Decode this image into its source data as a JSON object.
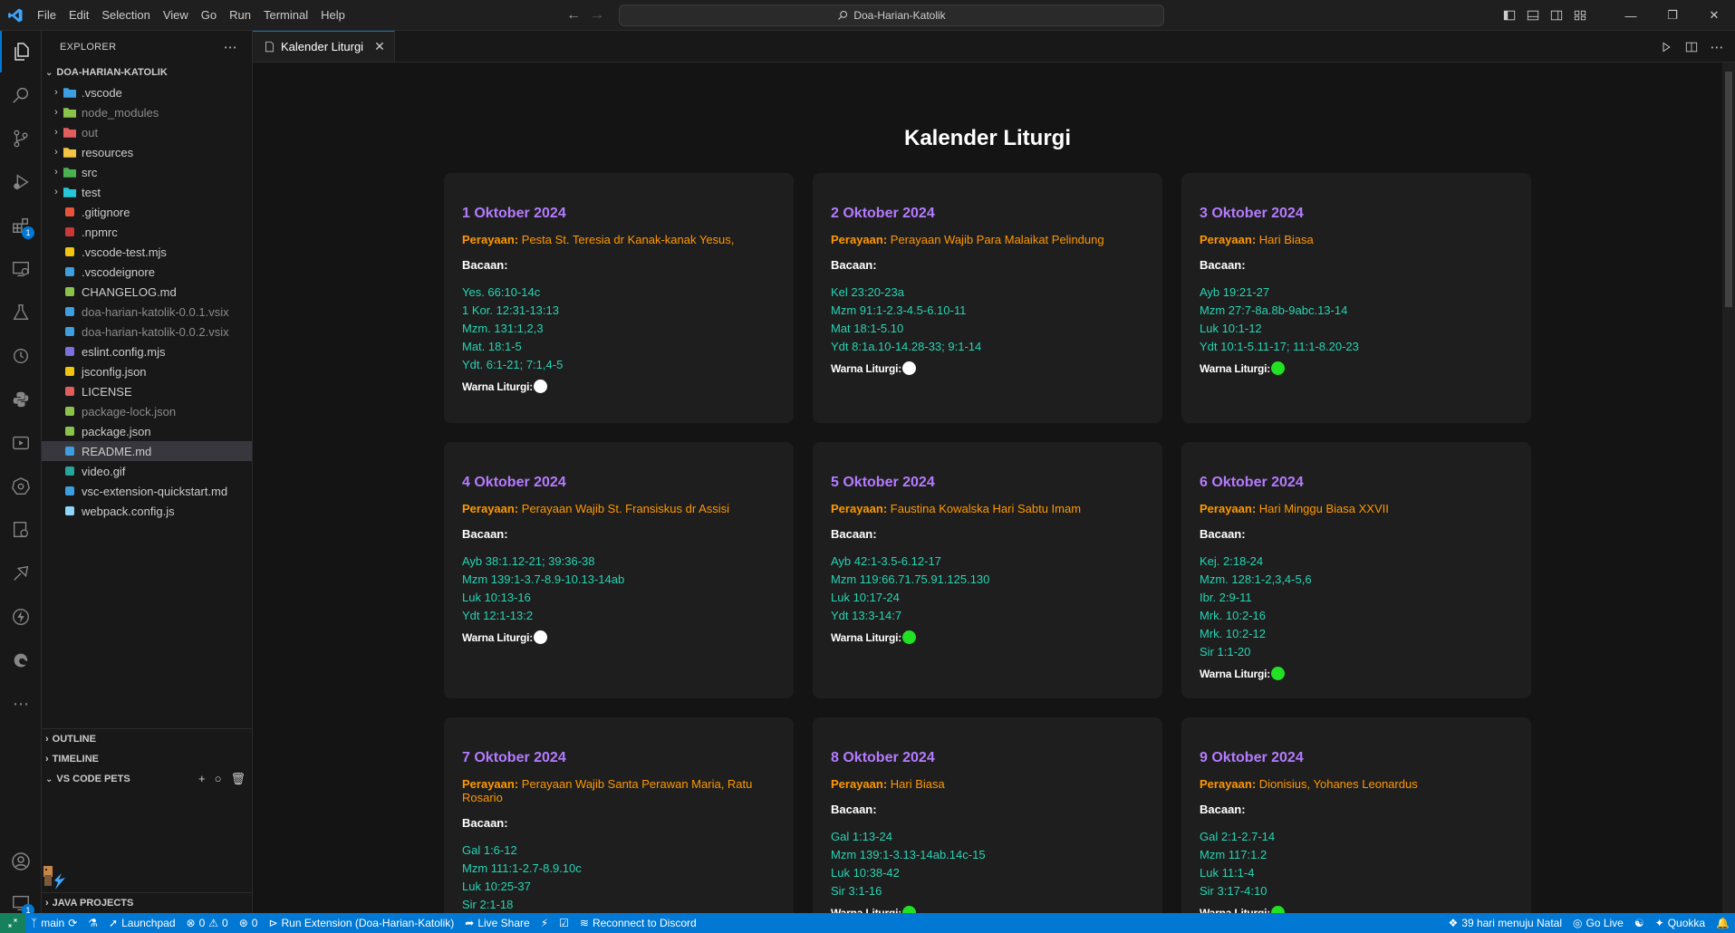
{
  "menu": [
    "File",
    "Edit",
    "Selection",
    "View",
    "Go",
    "Run",
    "Terminal",
    "Help"
  ],
  "search": {
    "text": "Doa-Harian-Katolik"
  },
  "explorer": {
    "header": "EXPLORER",
    "root": "DOA-HARIAN-KATOLIK",
    "items": [
      {
        "label": ".vscode",
        "folder": true,
        "icon": "folder-vscode-icon",
        "color": "#3d9fe0"
      },
      {
        "label": "node_modules",
        "folder": true,
        "icon": "folder-node-icon",
        "color": "#8bc34a",
        "dim": true
      },
      {
        "label": "out",
        "folder": true,
        "icon": "folder-out-icon",
        "color": "#e35d5d",
        "dim": true
      },
      {
        "label": "resources",
        "folder": true,
        "icon": "folder-resources-icon",
        "color": "#f4c542"
      },
      {
        "label": "src",
        "folder": true,
        "icon": "folder-src-icon",
        "color": "#4caf50"
      },
      {
        "label": "test",
        "folder": true,
        "icon": "folder-test-icon",
        "color": "#26c6da"
      },
      {
        "label": ".gitignore",
        "icon": "git-icon",
        "color": "#e8543a"
      },
      {
        "label": ".npmrc",
        "icon": "npm-icon",
        "color": "#cb3837"
      },
      {
        "label": ".vscode-test.mjs",
        "icon": "js-icon",
        "color": "#f1c40f"
      },
      {
        "label": ".vscodeignore",
        "icon": "vscode-icon",
        "color": "#3d9fe0"
      },
      {
        "label": "CHANGELOG.md",
        "icon": "changelog-icon",
        "color": "#8bc34a"
      },
      {
        "label": "doa-harian-katolik-0.0.1.vsix",
        "icon": "vsix-icon",
        "color": "#3d9fe0",
        "dim": true
      },
      {
        "label": "doa-harian-katolik-0.0.2.vsix",
        "icon": "vsix-icon",
        "color": "#3d9fe0",
        "dim": true
      },
      {
        "label": "eslint.config.mjs",
        "icon": "eslint-icon",
        "color": "#7c6fe0"
      },
      {
        "label": "jsconfig.json",
        "icon": "json-icon",
        "color": "#f1c40f"
      },
      {
        "label": "LICENSE",
        "icon": "license-icon",
        "color": "#e35d5d"
      },
      {
        "label": "package-lock.json",
        "icon": "package-icon",
        "color": "#8bc34a",
        "dim": true
      },
      {
        "label": "package.json",
        "icon": "package-icon",
        "color": "#8bc34a"
      },
      {
        "label": "README.md",
        "icon": "info-icon",
        "color": "#3d9fe0",
        "selected": true
      },
      {
        "label": "video.gif",
        "icon": "image-icon",
        "color": "#26a69a"
      },
      {
        "label": "vsc-extension-quickstart.md",
        "icon": "markdown-icon",
        "color": "#3d9fe0"
      },
      {
        "label": "webpack.config.js",
        "icon": "webpack-icon",
        "color": "#8ed6fb"
      }
    ],
    "outline": "OUTLINE",
    "timeline": "TIMELINE",
    "pets": "VS CODE PETS",
    "java": "JAVA PROJECTS"
  },
  "tab": {
    "label": "Kalender Liturgi"
  },
  "page": {
    "title": "Kalender Liturgi",
    "feast_label": "Perayaan:",
    "bacaan_label": "Bacaan:",
    "warna_label": "Warna Liturgi:",
    "cards": [
      {
        "date": "1 Oktober 2024",
        "feast": "Pesta St. Teresia dr Kanak-kanak Yesus,",
        "readings": [
          "Yes. 66:10-14c",
          "1 Kor. 12:31-13:13",
          "Mzm. 131:1,2,3",
          "Mat. 18:1-5",
          "Ydt. 6:1-21; 7:1,4-5"
        ],
        "color": "#ffffff"
      },
      {
        "date": "2 Oktober 2024",
        "feast": "Perayaan Wajib Para Malaikat Pelindung",
        "readings": [
          "Kel 23:20-23a",
          "Mzm 91:1-2.3-4.5-6.10-11",
          "Mat 18:1-5.10",
          "Ydt 8:1a.10-14.28-33; 9:1-14"
        ],
        "color": "#ffffff"
      },
      {
        "date": "3 Oktober 2024",
        "feast": "Hari Biasa",
        "readings": [
          "Ayb 19:21-27",
          "Mzm 27:7-8a.8b-9abc.13-14",
          "Luk 10:1-12",
          "Ydt 10:1-5.11-17; 11:1-8.20-23"
        ],
        "color": "#22e022"
      },
      {
        "date": "4 Oktober 2024",
        "feast": "Perayaan Wajib St. Fransiskus dr Assisi",
        "readings": [
          "Ayb 38:1.12-21; 39:36-38",
          "Mzm 139:1-3.7-8.9-10.13-14ab",
          "Luk 10:13-16",
          "Ydt 12:1-13:2"
        ],
        "color": "#ffffff"
      },
      {
        "date": "5 Oktober 2024",
        "feast": "Faustina Kowalska Hari Sabtu Imam",
        "readings": [
          "Ayb 42:1-3.5-6.12-17",
          "Mzm 119:66.71.75.91.125.130",
          "Luk 10:17-24",
          "Ydt 13:3-14:7"
        ],
        "color": "#22e022"
      },
      {
        "date": "6 Oktober 2024",
        "feast": "Hari Minggu Biasa XXVII",
        "readings": [
          "Kej. 2:18-24",
          "Mzm. 128:1-2,3,4-5,6",
          "Ibr. 2:9-11",
          "Mrk. 10:2-16",
          "Mrk. 10:2-12",
          "Sir 1:1-20"
        ],
        "color": "#22e022"
      },
      {
        "date": "7 Oktober 2024",
        "feast": "Perayaan Wajib Santa Perawan Maria, Ratu Rosario",
        "readings": [
          "Gal 1:6-12",
          "Mzm 111:1-2.7-8.9.10c",
          "Luk 10:25-37",
          "Sir 2:1-18"
        ],
        "color": "#ffffff"
      },
      {
        "date": "8 Oktober 2024",
        "feast": "Hari Biasa",
        "readings": [
          "Gal 1:13-24",
          "Mzm 139:1-3.13-14ab.14c-15",
          "Luk 10:38-42",
          "Sir 3:1-16"
        ],
        "color": "#22e022"
      },
      {
        "date": "9 Oktober 2024",
        "feast": "Dionisius, Yohanes Leonardus",
        "readings": [
          "Gal 2:1-2.7-14",
          "Mzm 117:1.2",
          "Luk 11:1-4",
          "Sir 3:17-4:10"
        ],
        "color": "#22e022"
      }
    ]
  },
  "statusbar": {
    "branch": "main",
    "launchpad": "Launchpad",
    "errors": "0",
    "warnings": "0",
    "ports": "0",
    "run": "Run Extension (Doa-Harian-Katolik)",
    "liveshare": "Live Share",
    "discord": "Reconnect to Discord",
    "natal": "39 hari menuju Natal",
    "golive": "Go Live",
    "quokka": "Quokka"
  }
}
